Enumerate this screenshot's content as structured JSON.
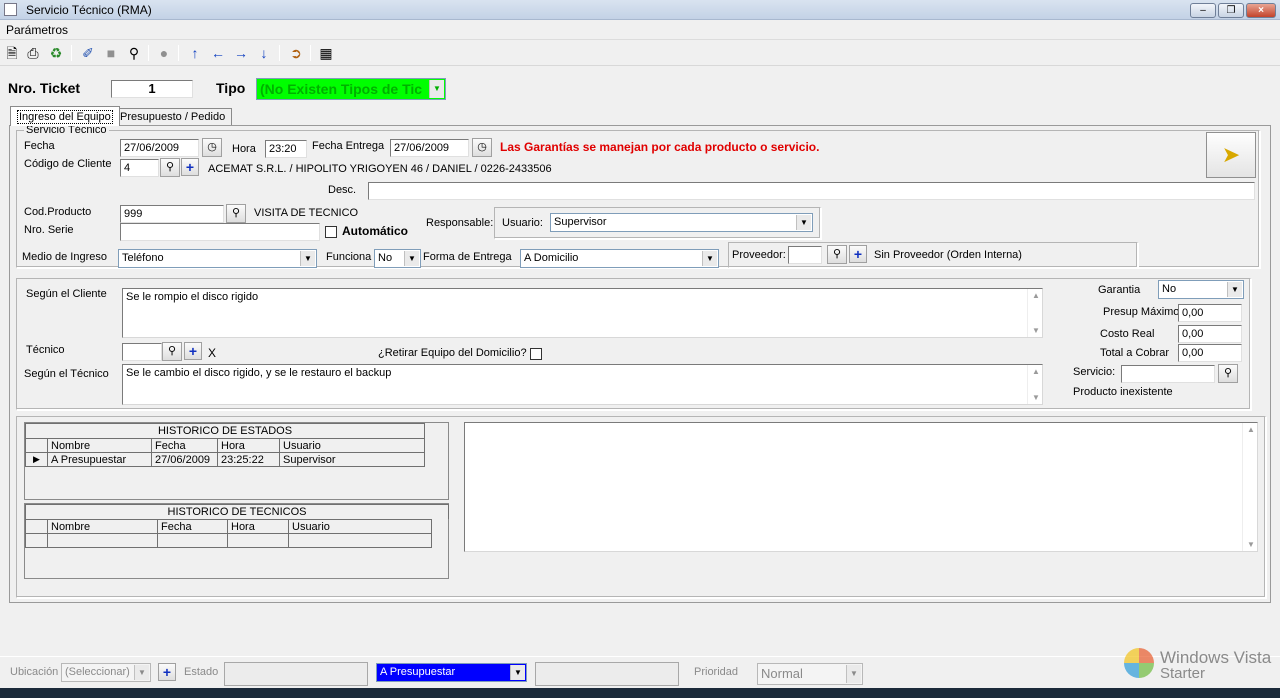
{
  "window": {
    "title": "Servicio Técnico (RMA)",
    "min": "0",
    "max": "1",
    "close": "x"
  },
  "menu": {
    "items": [
      "Parámetros"
    ]
  },
  "toolbar": {
    "icons": [
      "new-icon",
      "print-icon",
      "recycle-icon",
      "edit-icon",
      "stop-icon",
      "search-icon",
      "record-icon",
      "arrow-up-icon",
      "arrow-left-icon",
      "arrow-right-icon",
      "arrow-down-icon",
      "exit-icon",
      "book-icon"
    ]
  },
  "header": {
    "ticket_label": "Nro. Ticket",
    "ticket_value": "1",
    "tipo_label": "Tipo",
    "tipo_value": "(No Existen Tipos de Tic"
  },
  "tabs": [
    "Ingreso del Equipo",
    "Presupuesto / Pedido"
  ],
  "servicio": {
    "group_label": "Servicio Técnico",
    "fecha_label": "Fecha",
    "fecha_value": "27/06/2009",
    "hora_label": "Hora",
    "hora_value": "23:20",
    "fecha_entrega_label": "Fecha Entrega",
    "fecha_entrega_value": "27/06/2009",
    "warning": "Las Garantías se manejan por cada producto o servicio.",
    "cliente_label": "Código de Cliente",
    "cliente_value": "4",
    "cliente_info": "ACEMAT S.R.L. / HIPOLITO YRIGOYEN 46 / DANIEL / 0226-2433506",
    "desc_label": "Desc.",
    "desc_value": "",
    "producto_label": "Cod.Producto",
    "producto_value": "999",
    "producto_name": "VISITA DE TECNICO",
    "serie_label": "Nro. Serie",
    "serie_value": "",
    "automatico_label": "Automático",
    "responsable_label": "Responsable:",
    "usuario_label": "Usuario:",
    "usuario_value": "Supervisor",
    "medio_label": "Medio de Ingreso",
    "medio_value": "Teléfono",
    "funciona_label": "Funciona",
    "funciona_value": "No",
    "forma_label": "Forma de Entrega",
    "forma_value": "A Domicilio",
    "proveedor_label": "Proveedor:",
    "proveedor_value": "",
    "proveedor_name": "Sin Proveedor (Orden Interna)"
  },
  "detalle": {
    "cliente_label": "Según el Cliente",
    "cliente_text": "Se le rompio el disco rigido",
    "tecnico_label": "Técnico",
    "tecnico_value": "",
    "tecnico_clear": "X",
    "retirar_label": "¿Retirar Equipo del Domicilio?",
    "segun_tecnico_label": "Según el Técnico",
    "segun_tecnico_text": "Se le cambio el disco rigido, y se le restauro el backup",
    "garantia_label": "Garantia",
    "garantia_value": "No",
    "presup_label": "Presup Máximo",
    "presup_value": "0,00",
    "costo_label": "Costo Real",
    "costo_value": "0,00",
    "total_label": "Total a Cobrar",
    "total_value": "0,00",
    "servicio_label": "Servicio:",
    "servicio_value": "",
    "producto_status": "Producto inexistente"
  },
  "historico_estados": {
    "title": "HISTORICO DE ESTADOS",
    "columns": [
      "Nombre",
      "Fecha",
      "Hora",
      "Usuario"
    ],
    "rows": [
      [
        "A Presupuestar",
        "27/06/2009",
        "23:25:22",
        "Supervisor"
      ]
    ]
  },
  "historico_tecnicos": {
    "title": "HISTORICO DE TECNICOS",
    "columns": [
      "Nombre",
      "Fecha",
      "Hora",
      "Usuario"
    ]
  },
  "bottom": {
    "ubicacion_label": "Ubicación",
    "ubicacion_value": "(Seleccionar)",
    "estado_label": "Estado",
    "estado_value": "A Presupuestar",
    "prioridad_label": "Prioridad",
    "prioridad_value": "Normal"
  },
  "watermark": {
    "line1": "Windows Vista",
    "line2": "Starter"
  },
  "colors": {
    "tipo_bg": "#00ff00",
    "warning": "#e00000",
    "estado_bg": "#0000ff"
  }
}
